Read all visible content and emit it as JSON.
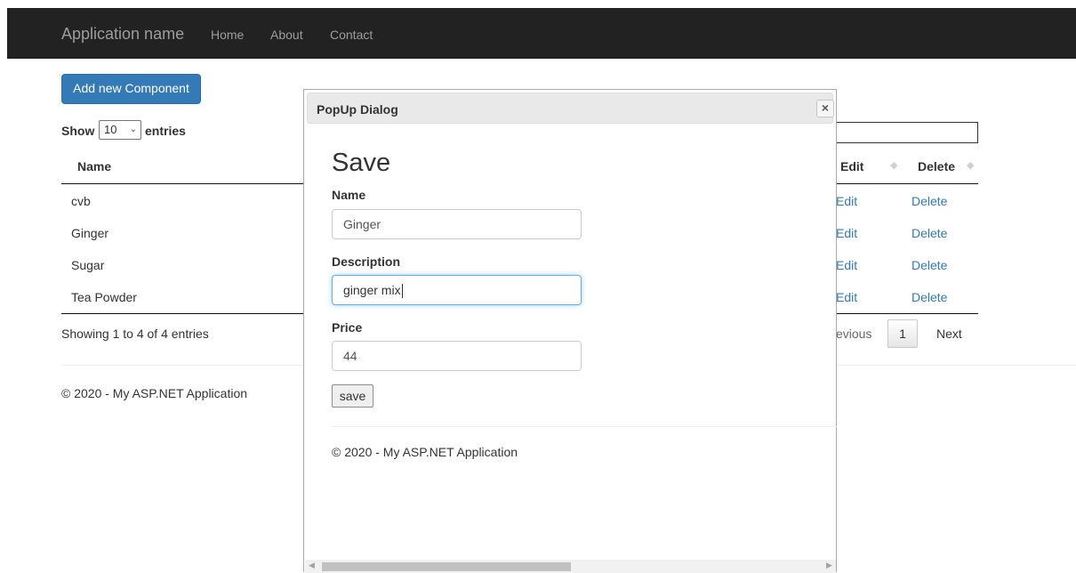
{
  "navbar": {
    "brand": "Application name",
    "links": [
      "Home",
      "About",
      "Contact"
    ]
  },
  "page": {
    "add_button": "Add new Component",
    "show_label": "Show",
    "entries_label": "entries",
    "page_length": "10",
    "columns": {
      "name": "Name",
      "edit": "Edit",
      "delete": "Delete"
    },
    "rows": [
      {
        "name": "cvb",
        "edit": "Edit",
        "delete": "Delete"
      },
      {
        "name": "Ginger",
        "edit": "Edit",
        "delete": "Delete"
      },
      {
        "name": "Sugar",
        "edit": "Edit",
        "delete": "Delete"
      },
      {
        "name": "Tea Powder",
        "edit": "Edit",
        "delete": "Delete"
      }
    ],
    "info": "Showing 1 to 4 of 4 entries",
    "pagination": {
      "previous": "evious",
      "current": "1",
      "next": "Next"
    },
    "footer": "© 2020 - My ASP.NET Application"
  },
  "dialog": {
    "title": "PopUp Dialog",
    "close_glyph": "×",
    "heading": "Save",
    "fields": {
      "name": {
        "label": "Name",
        "value": "Ginger"
      },
      "description": {
        "label": "Description",
        "value": "ginger mix"
      },
      "price": {
        "label": "Price",
        "value": "44"
      }
    },
    "save_button": "save",
    "footer": "© 2020 - My ASP.NET Application"
  },
  "colors": {
    "navbar_bg": "#222222",
    "primary": "#337ab7",
    "link": "#337ab7"
  },
  "icons": {
    "dropdown": "chevron-down-icon",
    "sort": "sort-icon",
    "close": "close-icon",
    "scroll_left": "arrow-left-icon",
    "scroll_right": "arrow-right-icon"
  }
}
